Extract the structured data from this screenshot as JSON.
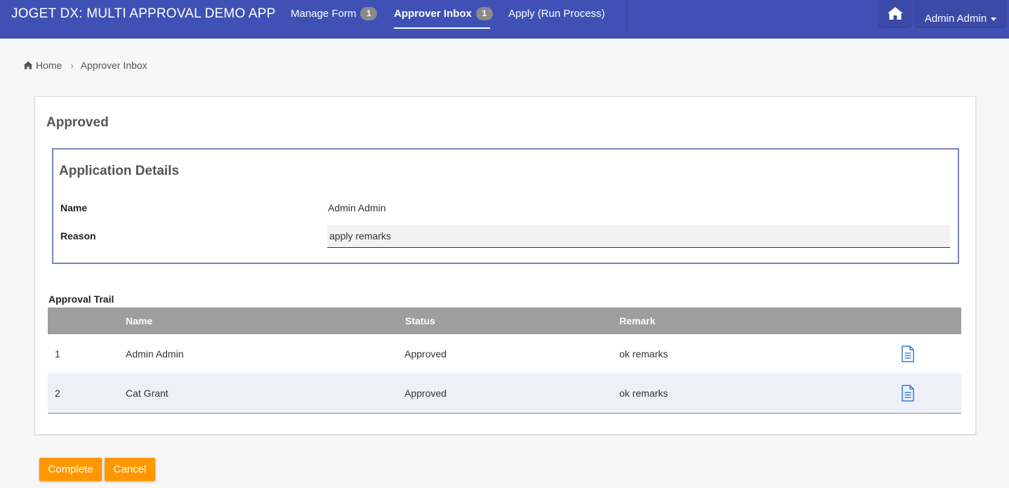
{
  "app": {
    "title": "JOGET DX: MULTI APPROVAL DEMO APP"
  },
  "nav": {
    "items": [
      {
        "label": "Manage Form",
        "badge": "1"
      },
      {
        "label": "Approver Inbox",
        "badge": "1"
      },
      {
        "label": "Apply (Run Process)"
      }
    ],
    "user_label": "Admin Admin",
    "home_icon": "home-icon"
  },
  "breadcrumb": {
    "home": "Home",
    "current": "Approver Inbox"
  },
  "form": {
    "title": "Approved",
    "section_title": "Application Details",
    "fields": [
      {
        "label": "Name",
        "value": "Admin Admin"
      },
      {
        "label": "Reason",
        "value": "apply remarks"
      }
    ],
    "trail": {
      "label": "Approval Trail",
      "columns": [
        "",
        "Name",
        "Status",
        "Remark"
      ],
      "rows": [
        {
          "no": "1",
          "name": "Admin Admin",
          "status": "Approved",
          "remark": "ok remarks"
        },
        {
          "no": "2",
          "name": "Cat Grant",
          "status": "Approved",
          "remark": "ok remarks"
        }
      ]
    }
  },
  "actions": {
    "complete": "Complete",
    "cancel": "Cancel"
  },
  "colors": {
    "topbar": "#3f51b5",
    "button": "#ff9800",
    "grid_header": "#9e9e9e",
    "link_icon": "#3a7bd5"
  }
}
